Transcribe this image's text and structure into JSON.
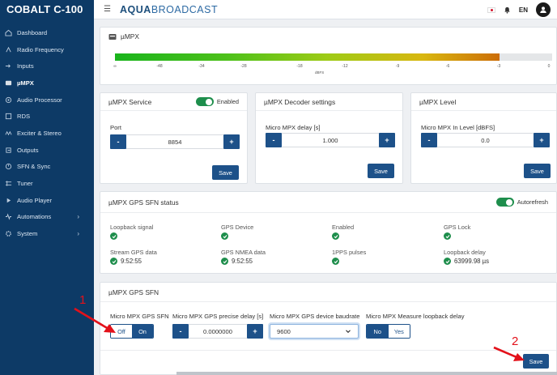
{
  "app": {
    "device": "COBALT C-100",
    "logo_bold": "AQUA",
    "logo_light": "BROADCAST",
    "language": "EN"
  },
  "sidebar": {
    "items": [
      {
        "label": "Dashboard",
        "icon": "home-icon"
      },
      {
        "label": "Radio Frequency",
        "icon": "signal-icon"
      },
      {
        "label": "Inputs",
        "icon": "input-icon"
      },
      {
        "label": "µMPX",
        "icon": "mpx-icon",
        "active": true
      },
      {
        "label": "Audio Processor",
        "icon": "processor-icon"
      },
      {
        "label": "RDS",
        "icon": "rds-icon"
      },
      {
        "label": "Exciter & Stereo",
        "icon": "exciter-icon"
      },
      {
        "label": "Outputs",
        "icon": "output-icon"
      },
      {
        "label": "SFN & Sync",
        "icon": "sync-icon"
      },
      {
        "label": "Tuner",
        "icon": "tuner-icon"
      },
      {
        "label": "Audio Player",
        "icon": "player-icon"
      },
      {
        "label": "Automations",
        "icon": "automation-icon",
        "has_children": true
      },
      {
        "label": "System",
        "icon": "system-icon",
        "has_children": true
      }
    ]
  },
  "mpx": {
    "title": "µMPX",
    "meter_level": 0.88,
    "scale": [
      "∞",
      "-48",
      "-34",
      "-28",
      "-18",
      "-12",
      "-9",
      "-6",
      "-3",
      "0"
    ],
    "scale_unit": "dBFS"
  },
  "service": {
    "title": "µMPX Service",
    "toggle_label": "Enabled",
    "enabled": true,
    "port_label": "Port",
    "port_value": "8854",
    "save": "Save"
  },
  "decoder": {
    "title": "µMPX Decoder settings",
    "field_label": "Micro MPX delay [s]",
    "value": "1.000",
    "save": "Save"
  },
  "level": {
    "title": "µMPX Level",
    "field_label": "Micro MPX In Level [dBFS]",
    "value": "0.0",
    "save": "Save"
  },
  "gps_status": {
    "title": "µMPX GPS SFN status",
    "autorefresh_label": "Autorefresh",
    "autorefresh": true,
    "row1": [
      {
        "label": "Loopback signal"
      },
      {
        "label": "GPS Device"
      },
      {
        "label": "Enabled"
      },
      {
        "label": "GPS Lock"
      }
    ],
    "row2": [
      {
        "label": "Stream GPS data",
        "value": "9:52:55"
      },
      {
        "label": "GPS NMEA data",
        "value": "9:52:55"
      },
      {
        "label": "1PPS pulses",
        "value": ""
      },
      {
        "label": "Loopback delay",
        "value": "63999.98 µs"
      }
    ]
  },
  "gps_sfn": {
    "title": "µMPX GPS SFN",
    "sfn_label": "Micro MPX GPS SFN",
    "sfn_off": "Off",
    "sfn_on": "On",
    "delay_label": "Micro MPX GPS precise delay [s]",
    "delay_value": "0.0000000",
    "baud_label": "Micro MPX GPS device baudrate",
    "baud_value": "9600",
    "loop_label": "Micro MPX Measure loopback delay",
    "loop_no": "No",
    "loop_yes": "Yes",
    "save": "Save"
  },
  "annotations": {
    "first": "1",
    "second": "2"
  },
  "colors": {
    "sidebar": "#0d3a66",
    "primary": "#1d5189",
    "success": "#1e8e4c",
    "annotation": "#e3111a"
  }
}
